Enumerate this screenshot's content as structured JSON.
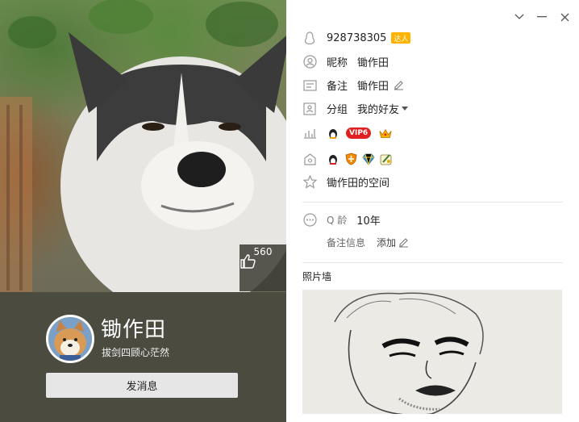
{
  "profile": {
    "like_count": "560",
    "nickname": "锄作田",
    "signature": "拔剑四顾心茫然",
    "message_button": "发消息"
  },
  "details": {
    "qq_number": "928738305",
    "talent_badge": "达人",
    "nickname_label": "昵称",
    "nickname_value": "锄作田",
    "remark_label": "备注",
    "remark_value": "锄作田",
    "group_label": "分组",
    "group_value": "我的好友",
    "vip_badge": "VIP6",
    "space_link": "锄作田的空间",
    "qage_label": "Q 龄",
    "qage_value": "10年",
    "remark_info": "备注信息",
    "add_label": "添加",
    "photo_wall_title": "照片墙"
  },
  "icons": {
    "window": [
      "chevron-down-icon",
      "minimize-icon",
      "close-icon"
    ]
  },
  "colors": {
    "left_panel": "#4b4b40",
    "vip_red": "#e02020",
    "talent_orange": "#ffb300"
  }
}
